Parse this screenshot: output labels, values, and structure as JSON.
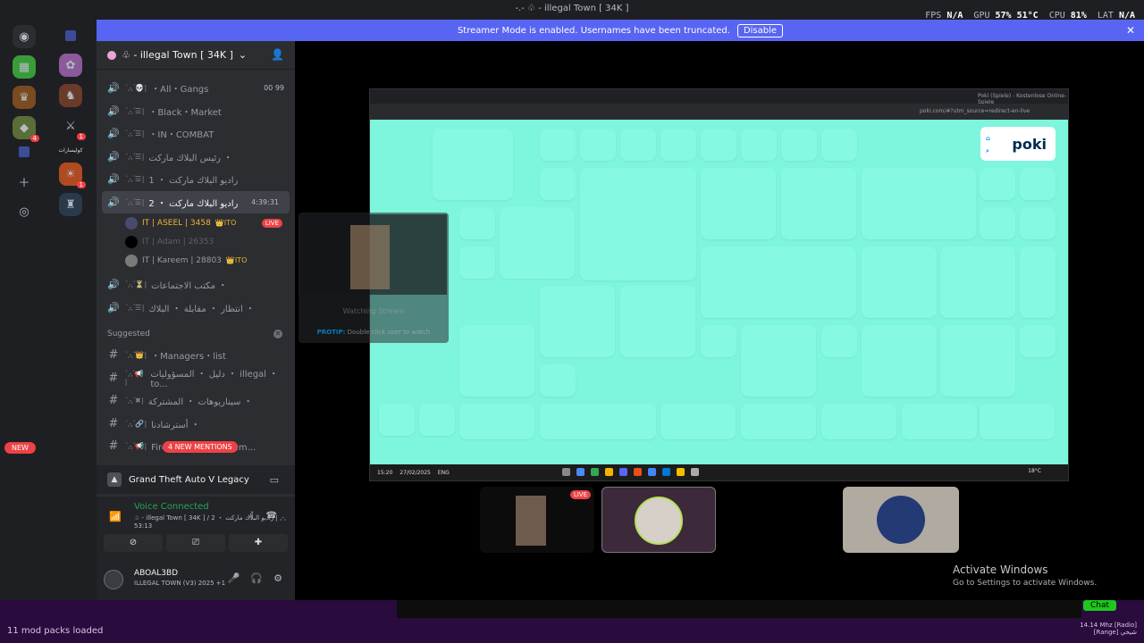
{
  "window": {
    "title": "-.- ♧ - illegal Town [ 34K ]"
  },
  "perf": {
    "fps_label": "FPS",
    "fps": "N/A",
    "gpu_label": "GPU",
    "gpu": "57% 51°C",
    "cpu_label": "CPU",
    "cpu": "81%",
    "lat_label": "LAT",
    "lat": "N/A"
  },
  "banner": {
    "text": "Streamer Mode is enabled. Usernames have been truncated.",
    "button": "Disable"
  },
  "server": {
    "name": "♧ - illegal Town [ 34K ]"
  },
  "channels": [
    {
      "name": "・All・Gangs",
      "deco": "ˋ,-,ˊ💀 |",
      "tail": "00 99"
    },
    {
      "name": "・Black・Market",
      "deco": "ˋ,-,ˊ☰ |",
      "tail": ""
    },
    {
      "name": "・IN・COMBAT",
      "deco": "ˋ,-,ˊ☰ |",
      "tail": ""
    },
    {
      "name": "رئيس البلاك ماركت ・",
      "deco": "ˋ,-,ˊ☰ |",
      "tail": ""
    },
    {
      "name": "راديو البلاك ماركت ・ 1",
      "deco": "ˋ,-,ˊ☰ |",
      "tail": ""
    }
  ],
  "active_channel": {
    "name": "راديو البلاك ماركت ・ 2",
    "deco": "ˋ,-,ˊ☰ |",
    "timer": "4:39:31"
  },
  "voice_users": [
    {
      "name": "IT | ASEEL | 3458",
      "tag": "👑ITO",
      "live": "LIVE"
    },
    {
      "name": "IT | Adam | 26353",
      "tag": "",
      "live": ""
    },
    {
      "name": "IT | Kareem | 28803",
      "tag": "👑ITO",
      "live": ""
    }
  ],
  "channels_after": [
    {
      "name": "مكتب الاجتماعات ・",
      "deco": "ˋ,-,ˊ⏳ |"
    },
    {
      "name": "انتظار ・ مقابلة ・ البلاك ・",
      "deco": "ˋ,-,ˊ☰ |"
    }
  ],
  "suggested": {
    "label": "Suggested",
    "items": [
      {
        "name": "・Managers・list",
        "deco": "ˋ,-,ˊ👑 |"
      },
      {
        "name": "دليل ・ المسؤوليات ・ illegal ・ to...",
        "deco": "ˋ,-,ˊ📢 |"
      },
      {
        "name": "سيناريوهات ・ المشتركة ・",
        "deco": "ˋ,-,ˊ✖ |"
      },
      {
        "name": "أسترشادنا ・",
        "deco": "ˋ,-,ˊ🔗 |"
      },
      {
        "name": "Firewall・Announcem...",
        "deco": "ˋ,-,ˊ📢 |"
      }
    ]
  },
  "pills": {
    "new": "NEW",
    "mentions": "4 NEW MENTIONS"
  },
  "activity": {
    "name": "Grand Theft Auto V Legacy"
  },
  "voice": {
    "status": "Voice Connected",
    "where": "♧ - illegal Town [ 34K ] / راديو البلاك ماركت ・ 2 | ,-,",
    "duration": "53:13"
  },
  "user": {
    "name": "ABOAL3BD",
    "status": "ILLEGAL TOWN (V3) 2025 +1"
  },
  "rail": {
    "label": "كوليسارات"
  },
  "browser": {
    "tab": "Poki (Spiele) - Kostenlose Online-Spiele",
    "url": "poki.com/#?utm_source=redirect-en-live"
  },
  "poki": {
    "logo": "poki"
  },
  "taskbar": {
    "time": "15:20",
    "date": "27/02/2025",
    "lang": "ENG",
    "weather": "18°C"
  },
  "popover": {
    "watching": "Watching Stream",
    "tip_label": "PROTIP:",
    "tip": "Double click user to watch"
  },
  "tiles": {
    "live": "LIVE"
  },
  "windows": {
    "activate_title": "Activate Windows",
    "activate_sub": "Go to Settings to activate Windows."
  },
  "bottom": {
    "mods": "11 mod packs loaded",
    "radio_freq": "14.14 Mhz [Radio]",
    "radio_name": "[Range] شيخي",
    "chat": "Chat"
  },
  "colors": {
    "accent": "#5865f2",
    "connected": "#23a55a",
    "danger": "#ed4245",
    "game_bg": "#7ef5dd"
  }
}
